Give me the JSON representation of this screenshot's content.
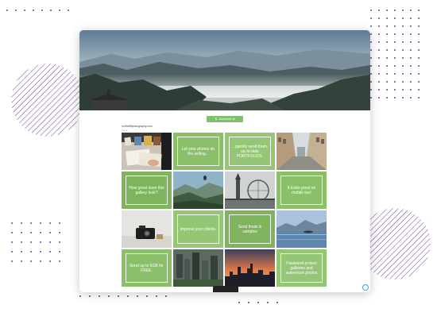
{
  "colors": {
    "accent_green": "#7ec26b",
    "tile_green": "#8bbf6a",
    "dot_purple": "#6b3aa0",
    "dot_gray": "#3d4b63"
  },
  "gallery": {
    "download_button": "Download all",
    "download_icon": "download-icon",
    "title": "northcliffphotography.com",
    "subtitle": "1 of 1",
    "tiles": [
      {
        "type": "photo",
        "name": "photo-desk"
      },
      {
        "type": "text",
        "text": "Let your photos do the selling..."
      },
      {
        "type": "text",
        "text": "...quickly send fresh, up-to-date PORTFOLIOS."
      },
      {
        "type": "photo",
        "name": "photo-street"
      },
      {
        "type": "text",
        "text": "How great does this gallery look?"
      },
      {
        "type": "photo",
        "name": "photo-valley"
      },
      {
        "type": "photo",
        "name": "photo-london"
      },
      {
        "type": "text",
        "text": "It looks great on mobile too!"
      },
      {
        "type": "photo",
        "name": "photo-camera"
      },
      {
        "type": "text",
        "text": "Impress your clients."
      },
      {
        "type": "text",
        "text": "Send finals & samples"
      },
      {
        "type": "photo",
        "name": "photo-lake"
      },
      {
        "type": "text",
        "text": "Send up to 5GB for FREE."
      },
      {
        "type": "photo",
        "name": "photo-aerial-city"
      },
      {
        "type": "photo",
        "name": "photo-sunset-skyline"
      },
      {
        "type": "text",
        "text": "Password protect galleries and watermark photos"
      }
    ]
  },
  "toolbar": {
    "prev_icon": "chevron-left-icon",
    "next_icon": "share-icon"
  }
}
